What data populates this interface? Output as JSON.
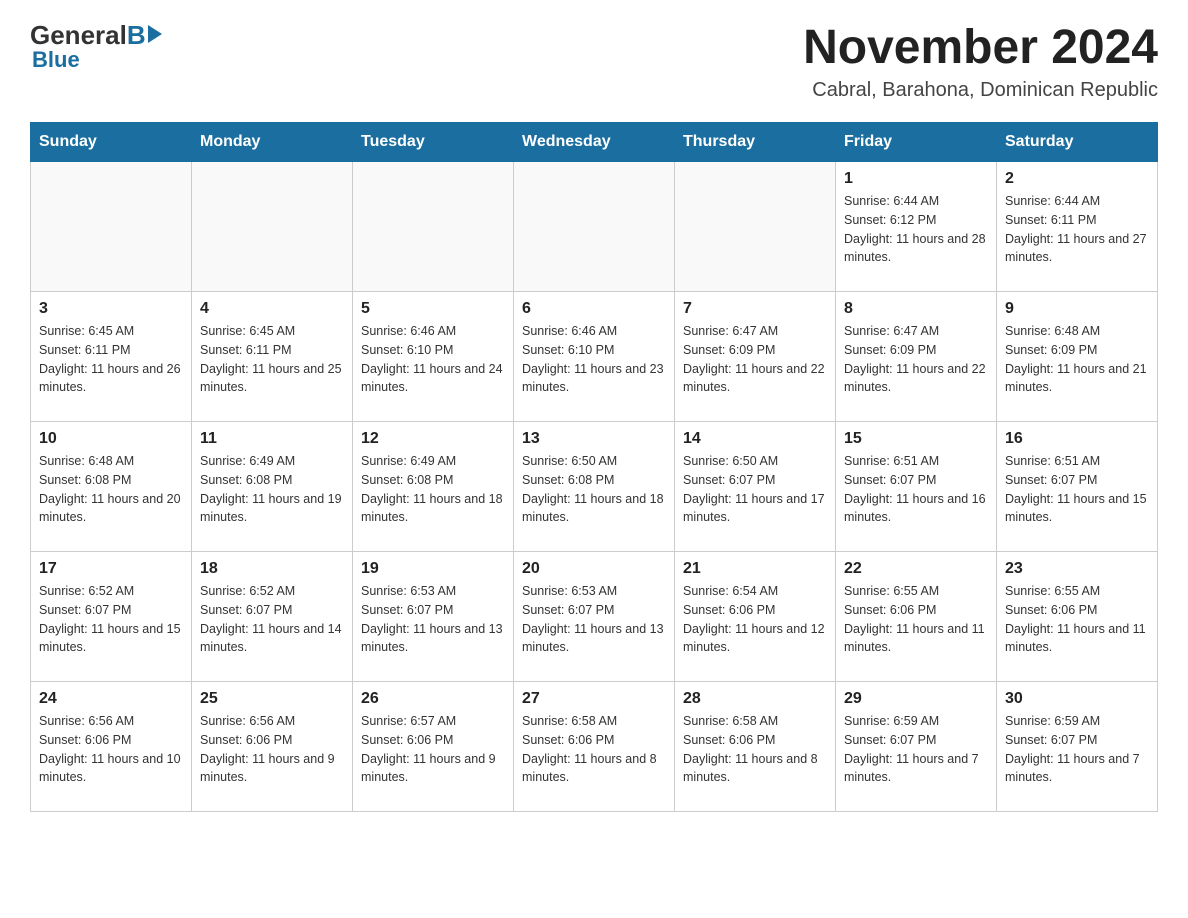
{
  "logo": {
    "general": "General",
    "blue": "Blue"
  },
  "header": {
    "month": "November 2024",
    "location": "Cabral, Barahona, Dominican Republic"
  },
  "days_of_week": [
    "Sunday",
    "Monday",
    "Tuesday",
    "Wednesday",
    "Thursday",
    "Friday",
    "Saturday"
  ],
  "weeks": [
    [
      {
        "day": "",
        "info": ""
      },
      {
        "day": "",
        "info": ""
      },
      {
        "day": "",
        "info": ""
      },
      {
        "day": "",
        "info": ""
      },
      {
        "day": "",
        "info": ""
      },
      {
        "day": "1",
        "info": "Sunrise: 6:44 AM\nSunset: 6:12 PM\nDaylight: 11 hours and 28 minutes."
      },
      {
        "day": "2",
        "info": "Sunrise: 6:44 AM\nSunset: 6:11 PM\nDaylight: 11 hours and 27 minutes."
      }
    ],
    [
      {
        "day": "3",
        "info": "Sunrise: 6:45 AM\nSunset: 6:11 PM\nDaylight: 11 hours and 26 minutes."
      },
      {
        "day": "4",
        "info": "Sunrise: 6:45 AM\nSunset: 6:11 PM\nDaylight: 11 hours and 25 minutes."
      },
      {
        "day": "5",
        "info": "Sunrise: 6:46 AM\nSunset: 6:10 PM\nDaylight: 11 hours and 24 minutes."
      },
      {
        "day": "6",
        "info": "Sunrise: 6:46 AM\nSunset: 6:10 PM\nDaylight: 11 hours and 23 minutes."
      },
      {
        "day": "7",
        "info": "Sunrise: 6:47 AM\nSunset: 6:09 PM\nDaylight: 11 hours and 22 minutes."
      },
      {
        "day": "8",
        "info": "Sunrise: 6:47 AM\nSunset: 6:09 PM\nDaylight: 11 hours and 22 minutes."
      },
      {
        "day": "9",
        "info": "Sunrise: 6:48 AM\nSunset: 6:09 PM\nDaylight: 11 hours and 21 minutes."
      }
    ],
    [
      {
        "day": "10",
        "info": "Sunrise: 6:48 AM\nSunset: 6:08 PM\nDaylight: 11 hours and 20 minutes."
      },
      {
        "day": "11",
        "info": "Sunrise: 6:49 AM\nSunset: 6:08 PM\nDaylight: 11 hours and 19 minutes."
      },
      {
        "day": "12",
        "info": "Sunrise: 6:49 AM\nSunset: 6:08 PM\nDaylight: 11 hours and 18 minutes."
      },
      {
        "day": "13",
        "info": "Sunrise: 6:50 AM\nSunset: 6:08 PM\nDaylight: 11 hours and 18 minutes."
      },
      {
        "day": "14",
        "info": "Sunrise: 6:50 AM\nSunset: 6:07 PM\nDaylight: 11 hours and 17 minutes."
      },
      {
        "day": "15",
        "info": "Sunrise: 6:51 AM\nSunset: 6:07 PM\nDaylight: 11 hours and 16 minutes."
      },
      {
        "day": "16",
        "info": "Sunrise: 6:51 AM\nSunset: 6:07 PM\nDaylight: 11 hours and 15 minutes."
      }
    ],
    [
      {
        "day": "17",
        "info": "Sunrise: 6:52 AM\nSunset: 6:07 PM\nDaylight: 11 hours and 15 minutes."
      },
      {
        "day": "18",
        "info": "Sunrise: 6:52 AM\nSunset: 6:07 PM\nDaylight: 11 hours and 14 minutes."
      },
      {
        "day": "19",
        "info": "Sunrise: 6:53 AM\nSunset: 6:07 PM\nDaylight: 11 hours and 13 minutes."
      },
      {
        "day": "20",
        "info": "Sunrise: 6:53 AM\nSunset: 6:07 PM\nDaylight: 11 hours and 13 minutes."
      },
      {
        "day": "21",
        "info": "Sunrise: 6:54 AM\nSunset: 6:06 PM\nDaylight: 11 hours and 12 minutes."
      },
      {
        "day": "22",
        "info": "Sunrise: 6:55 AM\nSunset: 6:06 PM\nDaylight: 11 hours and 11 minutes."
      },
      {
        "day": "23",
        "info": "Sunrise: 6:55 AM\nSunset: 6:06 PM\nDaylight: 11 hours and 11 minutes."
      }
    ],
    [
      {
        "day": "24",
        "info": "Sunrise: 6:56 AM\nSunset: 6:06 PM\nDaylight: 11 hours and 10 minutes."
      },
      {
        "day": "25",
        "info": "Sunrise: 6:56 AM\nSunset: 6:06 PM\nDaylight: 11 hours and 9 minutes."
      },
      {
        "day": "26",
        "info": "Sunrise: 6:57 AM\nSunset: 6:06 PM\nDaylight: 11 hours and 9 minutes."
      },
      {
        "day": "27",
        "info": "Sunrise: 6:58 AM\nSunset: 6:06 PM\nDaylight: 11 hours and 8 minutes."
      },
      {
        "day": "28",
        "info": "Sunrise: 6:58 AM\nSunset: 6:06 PM\nDaylight: 11 hours and 8 minutes."
      },
      {
        "day": "29",
        "info": "Sunrise: 6:59 AM\nSunset: 6:07 PM\nDaylight: 11 hours and 7 minutes."
      },
      {
        "day": "30",
        "info": "Sunrise: 6:59 AM\nSunset: 6:07 PM\nDaylight: 11 hours and 7 minutes."
      }
    ]
  ]
}
